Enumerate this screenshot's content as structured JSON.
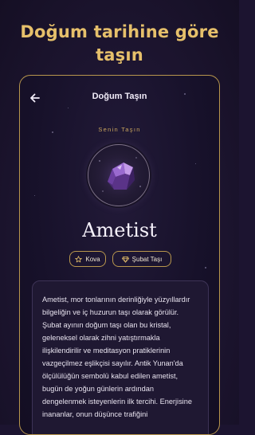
{
  "headline": {
    "line1": "Doğum tarihine göre",
    "line2": "taşın"
  },
  "screen": {
    "title": "Doğum Taşın",
    "sub_label": "Senin Taşın",
    "gem_name": "Ametist"
  },
  "chips": [
    {
      "label": "Kova",
      "icon": "star-icon"
    },
    {
      "label": "Şubat Taşı",
      "icon": "gem-icon"
    }
  ],
  "description": "Ametist, mor tonlarının derinliğiyle yüzyıllardır bilgeliğin ve iç huzurun taşı olarak görülür. Şubat ayının doğum taşı olan bu kristal, geleneksel olarak zihni yatıştırmakla ilişkilendirilir ve meditasyon pratiklerinin vazgeçilmez eşlikçisi sayılır. Antik Yunan'da ölçülülüğün sembolü kabul edilen ametist, bugün de yoğun günlerin ardından dengelenmek isteyenlerin ilk tercihi. Enerjisine inananlar, onun düşünce trafiğini",
  "colors": {
    "accent_gold": "#e6c06b",
    "frame_gold": "#b8964d",
    "background": "#1c1430",
    "amethyst": "#8a5cc4"
  }
}
